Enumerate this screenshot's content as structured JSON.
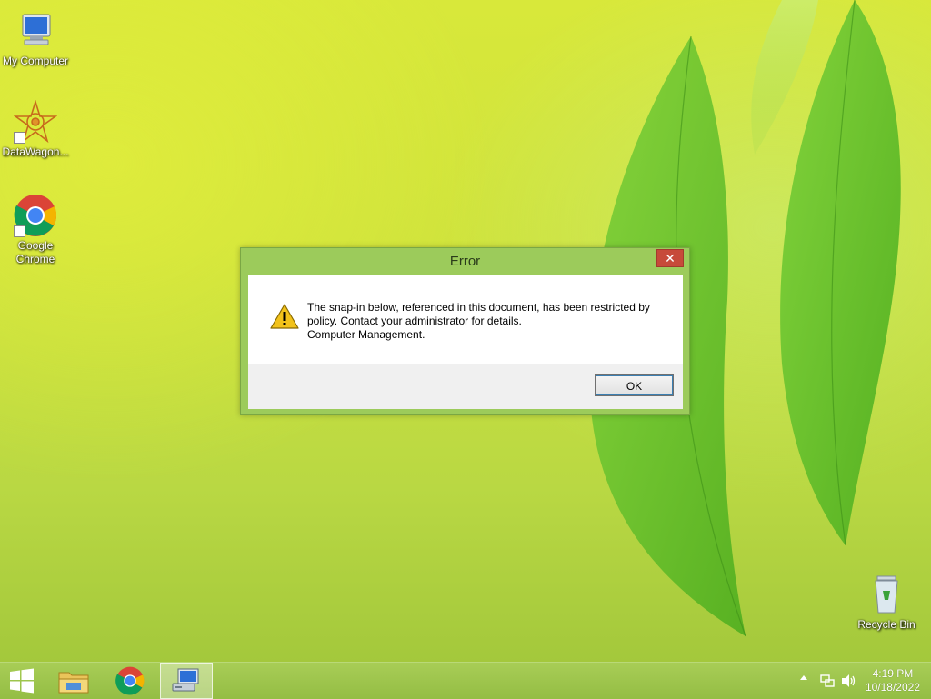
{
  "desktop": {
    "icons": [
      {
        "label": "My Computer"
      },
      {
        "label": "DataWagon..."
      },
      {
        "label_line1": "Google",
        "label_line2": "Chrome"
      },
      {
        "label": "Recycle Bin"
      }
    ]
  },
  "dialog": {
    "title": "Error",
    "close_label": "✕",
    "message_line1": "The snap-in below, referenced in this document, has been restricted by",
    "message_line2": "policy. Contact your administrator for details.",
    "message_line3": "Computer Management.",
    "ok_label": "OK"
  },
  "taskbar": {
    "items": [
      "start",
      "file-explorer",
      "google-chrome",
      "computer-management"
    ],
    "active_item": "computer-management",
    "time": "4:19 PM",
    "date": "10/18/2022"
  },
  "colors": {
    "dialog_frame": "#9ccb5b",
    "close_button": "#c74a3a",
    "taskbar": "#a8cd56"
  }
}
